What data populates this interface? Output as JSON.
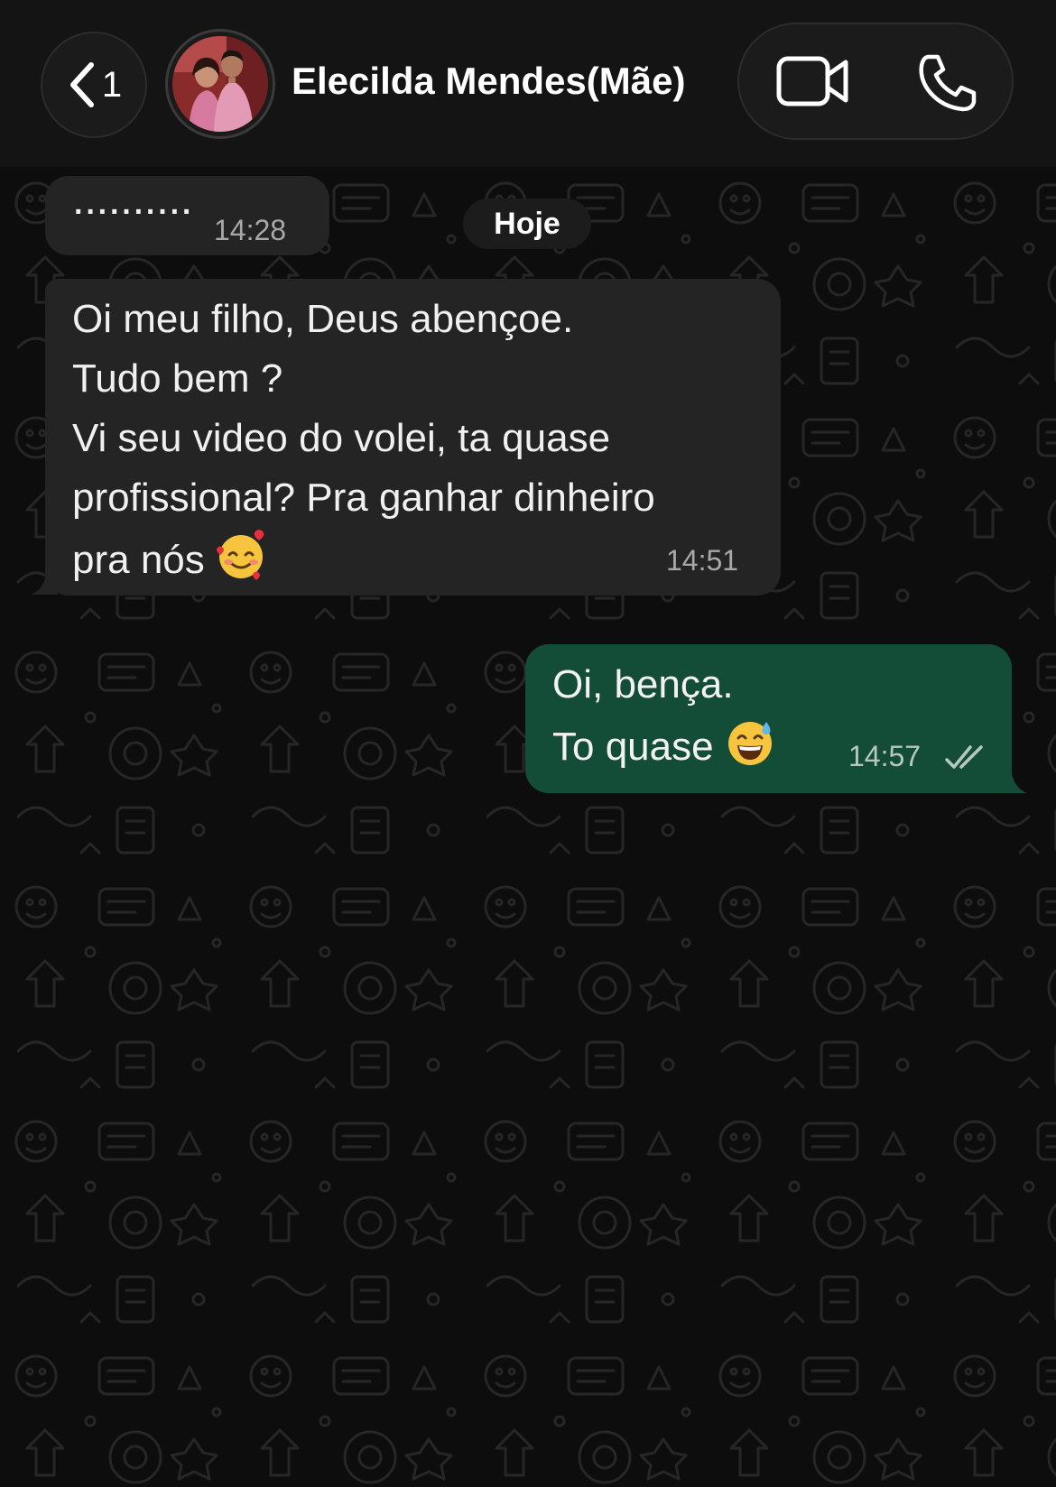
{
  "header": {
    "back_count": "1",
    "contact_name": "Elecilda Mendes(Mãe)"
  },
  "chat": {
    "date_label": "Hoje",
    "messages": [
      {
        "direction": "in",
        "text": "··········",
        "time": "14:28"
      },
      {
        "direction": "in",
        "text": "Oi meu filho, Deus abençoe.\nTudo bem ?\nVi seu video do volei, ta quase\nprofissional? Pra ganhar dinheiro\npra nós",
        "emoji": "smiling-face-with-hearts",
        "time": "14:51"
      },
      {
        "direction": "out",
        "text": "Oi, bença.\nTo quase",
        "emoji": "grinning-face-with-sweat",
        "time": "14:57",
        "status": "read"
      }
    ]
  },
  "colors": {
    "header_bg": "#141414",
    "chat_bg": "#0d0d0d",
    "incoming_bubble": "#242424",
    "outgoing_bubble": "#144d37",
    "read_ticks": "#b7c9bf"
  }
}
